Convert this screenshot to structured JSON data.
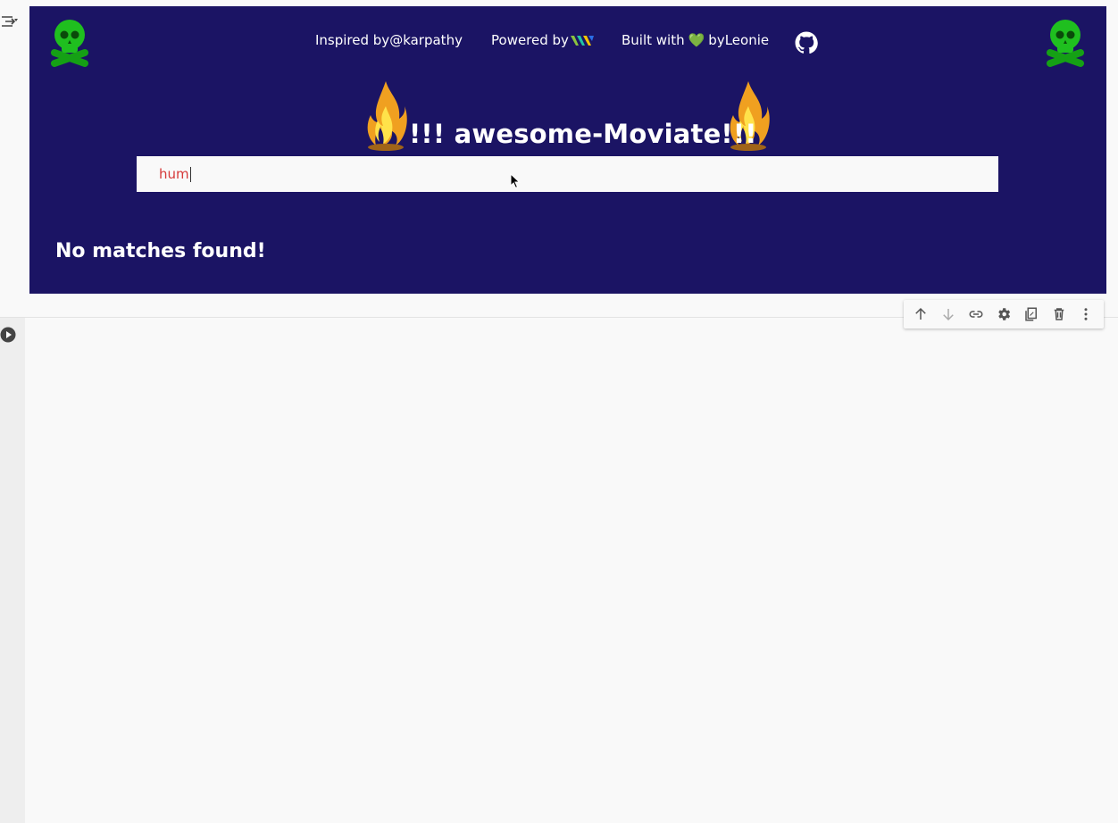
{
  "banner": {
    "inspired_label": "Inspired by@karpathy",
    "powered_label": "Powered by",
    "built_prefix": "Built with",
    "built_heart": "💚",
    "built_suffix": "byLeonie",
    "title": "!!! awesome-Moviate!!!"
  },
  "search": {
    "value": "hum"
  },
  "results": {
    "message": "No matches found!"
  },
  "colors": {
    "banner_bg": "#1b1464",
    "search_text": "#d63a3a",
    "skull": "#19b21b"
  },
  "icons": {
    "banner": [
      "skull-crossbones-icon",
      "weaviate-logo-icon",
      "github-icon",
      "fire-icon"
    ],
    "toolbar": [
      "arrow-up-icon",
      "arrow-down-icon",
      "link-icon",
      "gear-icon",
      "mirror-cell-icon",
      "trash-icon",
      "more-vert-icon"
    ]
  }
}
